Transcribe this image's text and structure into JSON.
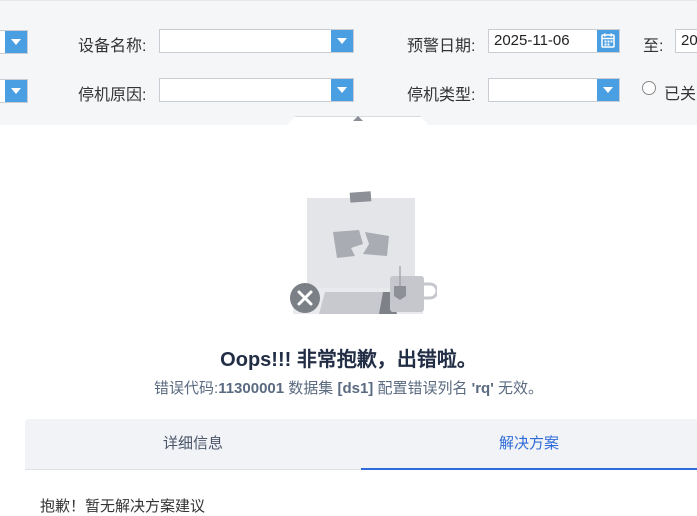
{
  "filters": {
    "device_name_label": "设备名称:",
    "warning_date_label": "预警日期:",
    "warning_date_value": "2025-11-06",
    "to_label": "至:",
    "to_date_value": "20",
    "stop_reason_label": "停机原因:",
    "stop_type_label": "停机类型:",
    "closed_radio_label": "已关"
  },
  "error": {
    "title": "Oops!!! 非常抱歉，出错啦。",
    "message_prefix": "错误代码:",
    "code": "11300001",
    "dataset_text": " 数据集 ",
    "dataset": "[ds1]",
    "column_text": " 配置错误列名 ",
    "column": "'rq'",
    "message_suffix": " 无效。"
  },
  "tabs": {
    "detail_label": "详细信息",
    "solution_label": "解决方案",
    "active": "solution",
    "solution_content": "抱歉！暂无解决方案建议"
  },
  "colors": {
    "accent": "#2f6bd8",
    "dropdown_button": "#4a9fe3",
    "title": "#222e45",
    "error_badge": "#7b7f86"
  },
  "icons": {
    "dropdown": "chevron-down-icon",
    "calendar": "calendar-icon",
    "error_badge": "close-icon",
    "collapse": "chevron-up-icon"
  }
}
